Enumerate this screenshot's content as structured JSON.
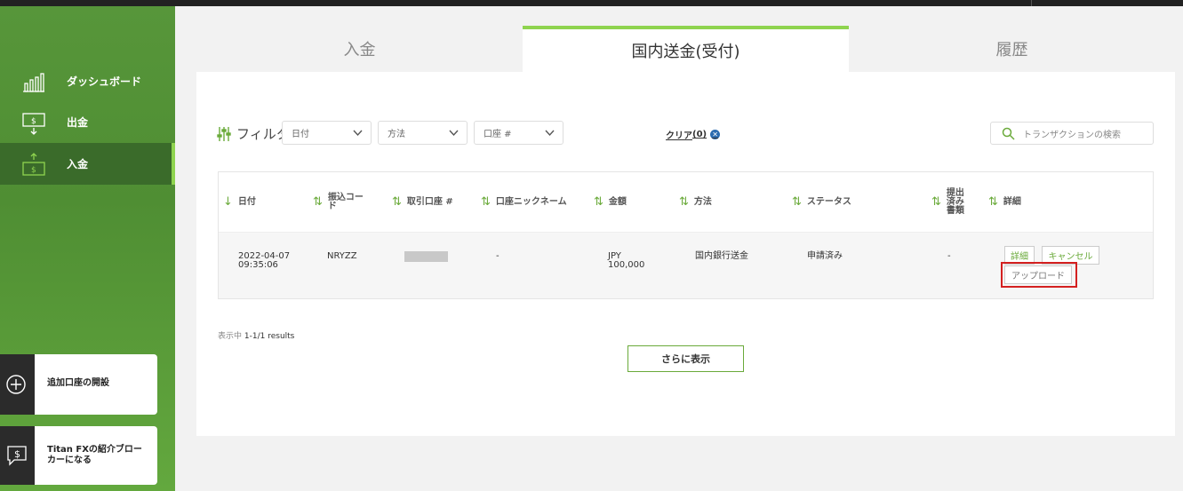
{
  "sidebar": {
    "items": [
      {
        "label": "ダッシュボード",
        "icon": "bar-chart-icon"
      },
      {
        "label": "出金",
        "icon": "withdraw-icon"
      },
      {
        "label": "入金",
        "icon": "deposit-icon",
        "active": true
      }
    ],
    "promos": [
      {
        "label": "追加口座の開設",
        "icon": "plus-circle-icon"
      },
      {
        "label": "Titan FXの紹介ブローカーになる",
        "icon": "dollar-chat-icon"
      }
    ]
  },
  "tabs": [
    {
      "label": "入金"
    },
    {
      "label": "国内送金(受付)",
      "active": true
    },
    {
      "label": "履歴"
    }
  ],
  "filters": {
    "label": "フィルタ",
    "date": "日付",
    "method": "方法",
    "account": "口座 #",
    "clear_label": "クリア",
    "clear_count": "(0)",
    "search_placeholder": "トランザクションの検索"
  },
  "table": {
    "headers": [
      "日付",
      "振込コード",
      "取引口座 #",
      "口座ニックネーム",
      "金額",
      "方法",
      "ステータス",
      "提出済み書類",
      "詳細"
    ],
    "rows": [
      {
        "date": "2022-04-07",
        "time": "09:35:06",
        "code": "NRYZZ",
        "account": "",
        "nickname": "-",
        "currency": "JPY",
        "amount": "100,000",
        "method": "国内銀行送金",
        "status": "申請済み",
        "documents": "-",
        "detail_button": "詳細",
        "cancel_button": "キャンセル",
        "upload_button": "アップロード"
      }
    ]
  },
  "footer": {
    "results_prefix": "表示中",
    "results_text": "1-1/1 results",
    "more_button": "さらに表示"
  },
  "colors": {
    "accent_green": "#8fd44f",
    "sidebar_green": "#57963a",
    "highlight_red": "#d42020"
  }
}
